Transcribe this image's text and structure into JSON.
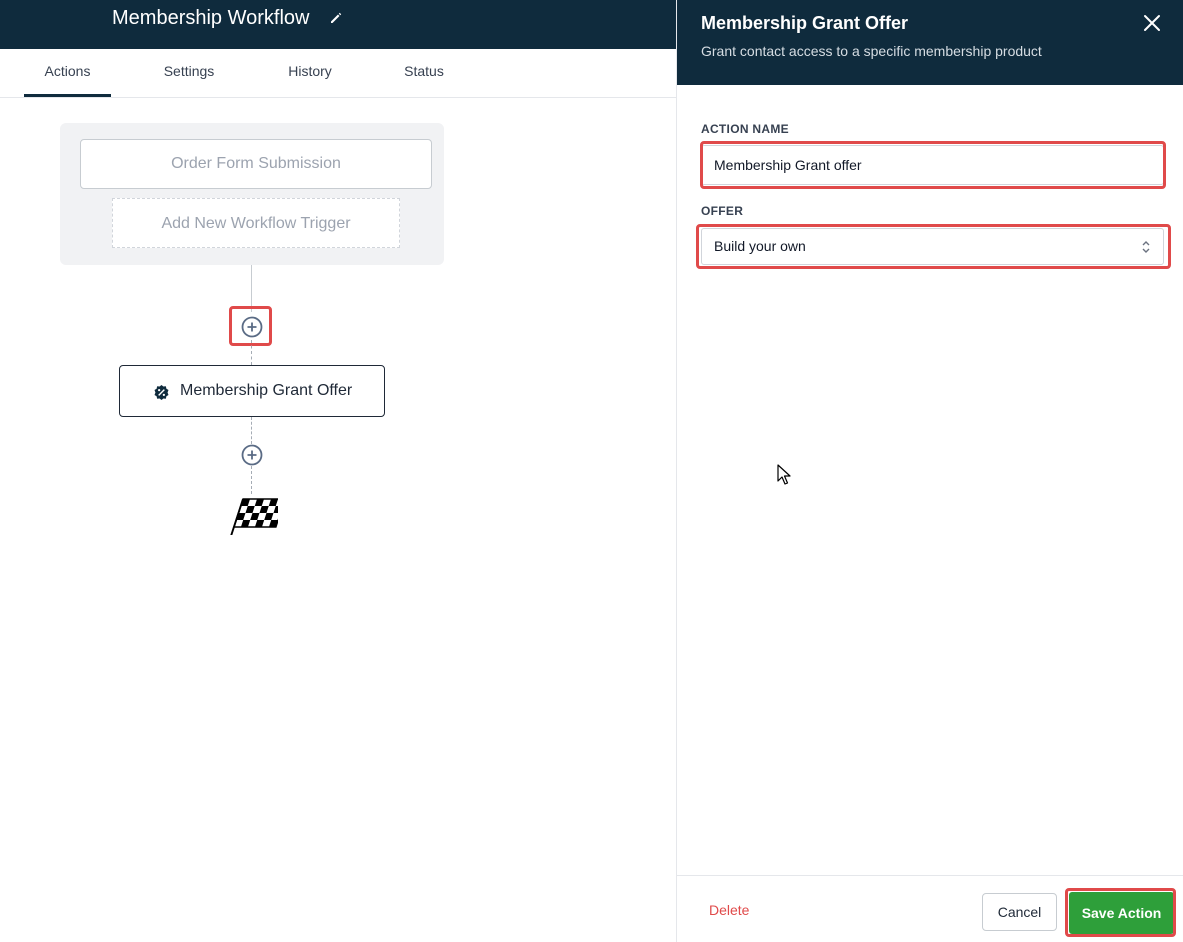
{
  "workflow": {
    "title": "Membership Workflow",
    "edit_icon": "pencil-icon"
  },
  "tabs": [
    {
      "label": "Actions",
      "active": true
    },
    {
      "label": "Settings",
      "active": false
    },
    {
      "label": "History",
      "active": false
    },
    {
      "label": "Status",
      "active": false
    }
  ],
  "canvas": {
    "trigger": "Order Form Submission",
    "add_trigger": "Add New Workflow Trigger",
    "action": {
      "label": "Membership Grant Offer",
      "icon": "badge-percent-icon"
    },
    "finish_icon": "checkered-flag-icon",
    "add_step_icon": "plus-circle-icon"
  },
  "panel": {
    "title": "Membership Grant Offer",
    "subtitle": "Grant contact access to a specific membership product",
    "close_icon": "close-icon",
    "action_name_label": "ACTION NAME",
    "action_name_value": "Membership Grant offer",
    "offer_label": "OFFER",
    "offer_value": "Build your own",
    "delete_label": "Delete",
    "cancel_label": "Cancel",
    "save_label": "Save Action"
  },
  "colors": {
    "header_bg": "#0f2b3d",
    "highlight": "#e04a4a",
    "save_green": "#2e9f3a",
    "delete_red": "#e04a4a"
  }
}
